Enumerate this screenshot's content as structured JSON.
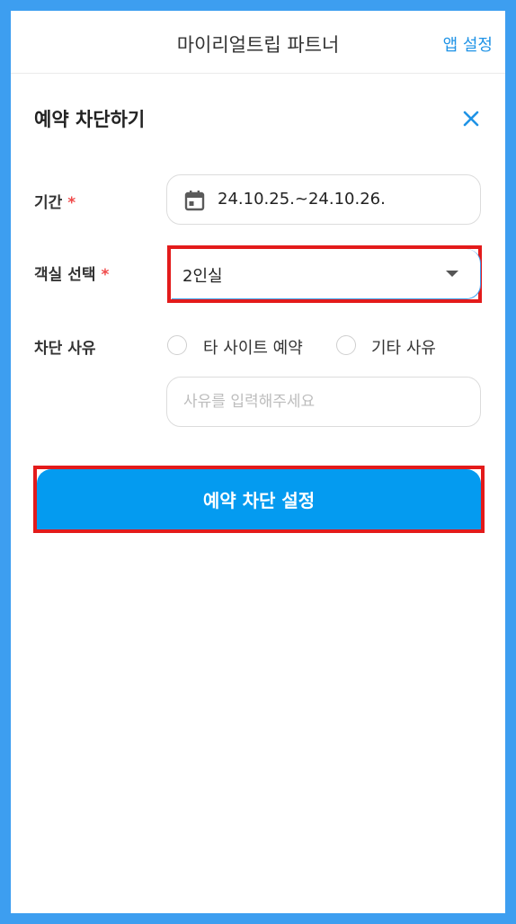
{
  "header": {
    "title": "마이리얼트립 파트너",
    "app_settings_label": "앱 설정"
  },
  "dialog": {
    "title": "예약 차단하기",
    "close_icon": "close-icon"
  },
  "form": {
    "period": {
      "label": "기간",
      "required_mark": "*",
      "value": "24.10.25.~24.10.26.",
      "icon": "calendar-icon"
    },
    "room": {
      "label": "객실 선택",
      "required_mark": "*",
      "selected_value": "2인실"
    },
    "reason": {
      "label": "차단 사유",
      "options": [
        "타 사이트 예약",
        "기타 사유"
      ],
      "input_placeholder": "사유를 입력해주세요"
    }
  },
  "submit_label": "예약 차단 설정",
  "colors": {
    "accent": "#049bf0",
    "link": "#1f93e6",
    "required": "#f04a4a",
    "highlight": "#e31b1b",
    "frame": "#3d9ef0"
  }
}
